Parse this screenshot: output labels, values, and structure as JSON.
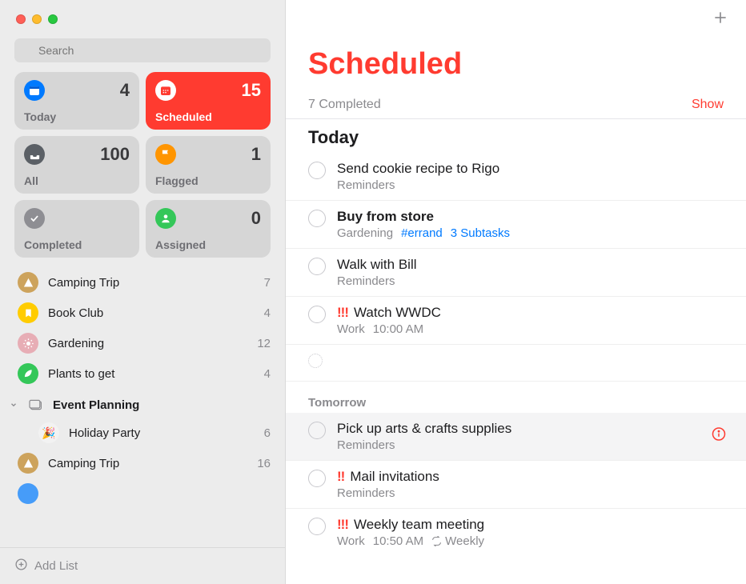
{
  "search": {
    "placeholder": "Search"
  },
  "smart_lists": {
    "today": {
      "label": "Today",
      "count": "4",
      "icon_bg": "#007aff"
    },
    "scheduled": {
      "label": "Scheduled",
      "count": "15",
      "icon_bg": "#ffffff"
    },
    "all": {
      "label": "All",
      "count": "100",
      "icon_bg": "#5b6066"
    },
    "flagged": {
      "label": "Flagged",
      "count": "1",
      "icon_bg": "#ff9500"
    },
    "completed": {
      "label": "Completed",
      "count": "",
      "icon_bg": "#8e8e93"
    },
    "assigned": {
      "label": "Assigned",
      "count": "0",
      "icon_bg": "#34c759"
    }
  },
  "lists": [
    {
      "name": "Camping Trip",
      "count": "7",
      "color": "#cda35c",
      "icon": "tent"
    },
    {
      "name": "Book Club",
      "count": "4",
      "color": "#ffcc00",
      "icon": "bookmark"
    },
    {
      "name": "Gardening",
      "count": "12",
      "color": "#e7adb5",
      "icon": "sun"
    },
    {
      "name": "Plants to get",
      "count": "4",
      "color": "#34c759",
      "icon": "leaf"
    }
  ],
  "folder": {
    "name": "Event Planning",
    "children": [
      {
        "name": "Holiday Party",
        "count": "6",
        "emoji": "🎉"
      },
      {
        "name": "Camping Trip",
        "count": "16",
        "color": "#cda35c",
        "icon": "tent"
      }
    ]
  },
  "add_list_label": "Add List",
  "main": {
    "title": "Scheduled",
    "completed_summary": "7 Completed",
    "show_label": "Show",
    "sections": [
      {
        "title": "Today",
        "big": true,
        "items": [
          {
            "title": "Send cookie recipe to Rigo",
            "sub": "Reminders"
          },
          {
            "title": "Buy from store",
            "bold": true,
            "sub": "Gardening",
            "tag": "#errand",
            "subtasks": "3 Subtasks"
          },
          {
            "title": "Walk with Bill",
            "sub": "Reminders"
          },
          {
            "priority": "!!!",
            "title": "Watch WWDC",
            "sub": "Work",
            "time": "10:00 AM"
          }
        ]
      },
      {
        "title": "Tomorrow",
        "big": false,
        "items": [
          {
            "title": "Pick up arts & crafts supplies",
            "sub": "Reminders",
            "selected": true,
            "info": true
          },
          {
            "priority": "!!",
            "title": "Mail invitations",
            "sub": "Reminders"
          },
          {
            "priority": "!!!",
            "title": "Weekly team meeting",
            "sub": "Work",
            "time": "10:50 AM",
            "recurrence": "Weekly"
          }
        ]
      }
    ]
  }
}
